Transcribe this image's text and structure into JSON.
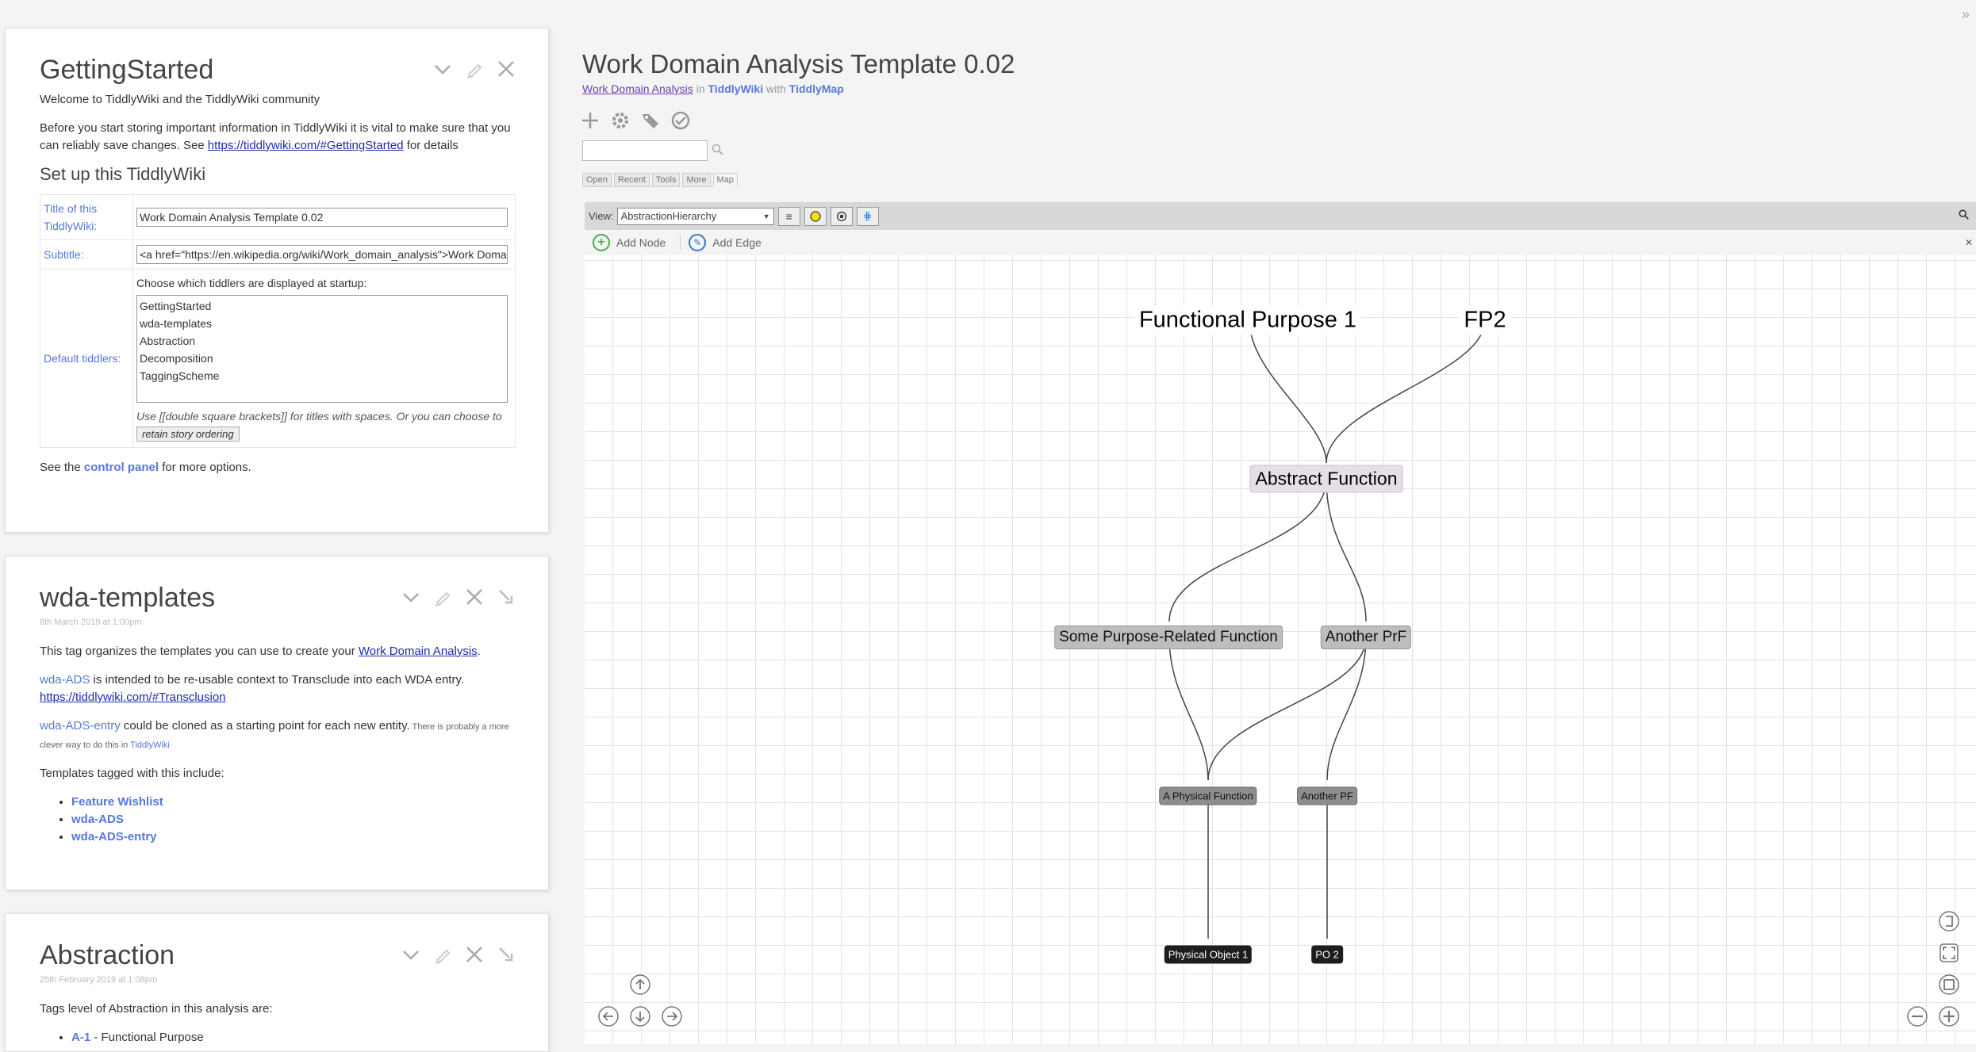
{
  "tiddlers": [
    {
      "title": "GettingStarted",
      "welcome": "Welcome to TiddlyWiki and the TiddlyWiki community",
      "before_text": "Before you start storing important information in TiddlyWiki it is vital to make sure that you can reliably save changes. See ",
      "before_link": "https://tiddlywiki.com/#GettingStarted",
      "before_tail": " for details",
      "setup_heading": "Set up this TiddlyWiki",
      "title_label": "Title of this TiddlyWiki:",
      "title_value": "Work Domain Analysis Template 0.02",
      "subtitle_label": "Subtitle:",
      "subtitle_value": "<a href=\"https://en.wikipedia.org/wiki/Work_domain_analysis\">Work Domain Analysis</a>",
      "default_label": "Default tiddlers:",
      "default_caption": "Choose which tiddlers are displayed at startup:",
      "default_items": [
        "GettingStarted",
        "wda-templates",
        "Abstraction",
        "Decomposition",
        "TaggingScheme"
      ],
      "hint_text": "Use [[double square brackets]] for titles with spaces. Or you can choose to",
      "hint_button": "retain story ordering",
      "see_pre": "See the ",
      "see_link": "control panel",
      "see_post": " for more options."
    },
    {
      "title": "wda-templates",
      "date": "6th March 2019 at 1:00pm",
      "p1_pre": "This tag organizes the templates you can use to create your ",
      "p1_link": "Work Domain Analysis",
      "p1_post": ".",
      "p2_link": "wda-ADS",
      "p2_text": " is intended to be re-usable context to Transclude into each WDA entry.",
      "p2_url": "https://tiddlywiki.com/#Transclusion",
      "p3_link": "wda-ADS-entry",
      "p3_text": " could be cloned as a starting point for each new entity.",
      "p3_small": " There is probably a more clever way to do this in ",
      "p3_small_link": "TiddlyWiki",
      "p4": "Templates tagged with this include:",
      "items": [
        "Feature Wishlist",
        "wda-ADS",
        "wda-ADS-entry"
      ]
    },
    {
      "title": "Abstraction",
      "date": "25th February 2019 at 1:08pm",
      "p1": "Tags level of Abstraction in this analysis are:",
      "item_link": "A-1",
      "item_text": " - Functional Purpose"
    }
  ],
  "site": {
    "title": "Work Domain Analysis Template 0.02",
    "sub_link1": "Work Domain Analysis",
    "sub_in": " in ",
    "sub_link2": "TiddlyWiki",
    "sub_with": " with ",
    "sub_link3": "TiddlyMap"
  },
  "tabs": [
    "Open",
    "Recent",
    "Tools",
    "More",
    "Map"
  ],
  "map": {
    "view_label": "View:",
    "view_value": "AbstractionHierarchy",
    "add_node": "Add Node",
    "add_edge": "Add Edge",
    "nodes": {
      "fp1": "Functional Purpose 1",
      "fp2": "FP2",
      "af": "Abstract Function",
      "prf1": "Some Purpose-Related Function",
      "prf2": "Another PrF",
      "pf1": "A Physical Function",
      "pf2": "Another PF",
      "po1": "Physical Object 1",
      "po2": "PO 2"
    }
  }
}
